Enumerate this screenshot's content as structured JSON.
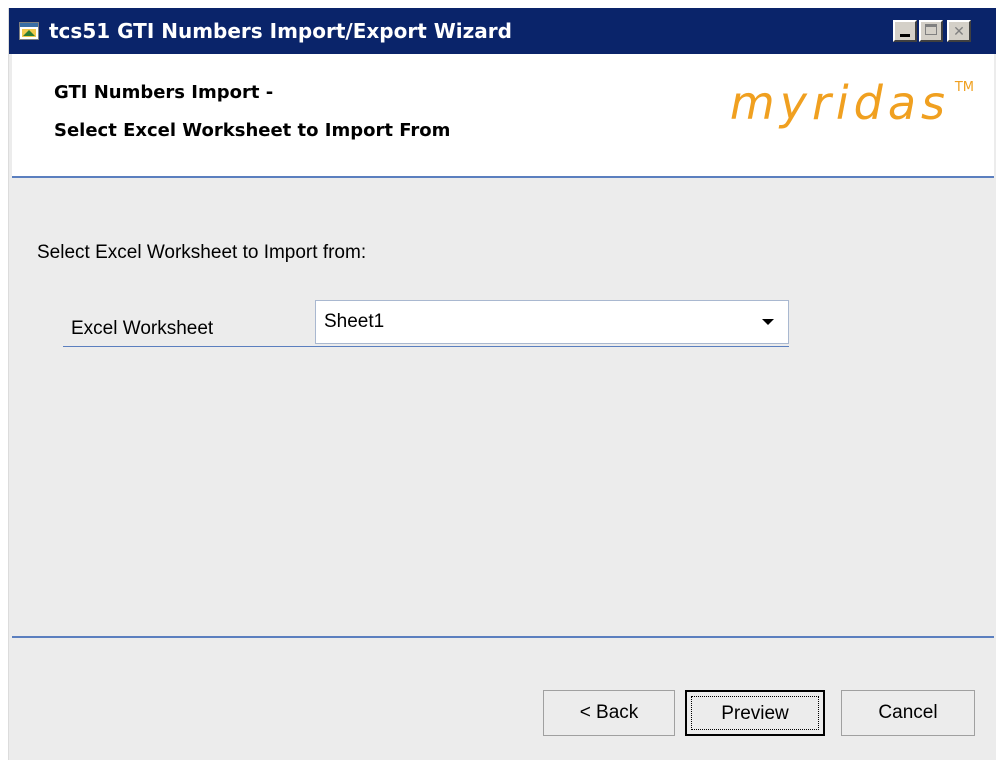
{
  "window": {
    "title": "tcs51 GTI Numbers Import/Export Wizard",
    "icon": "wizard-app-icon",
    "title_bar_color": "#0a246a"
  },
  "header": {
    "line1": "GTI Numbers Import -",
    "line2": "Select Excel Worksheet to Import From",
    "brand": "myridas",
    "brand_tm": "TM",
    "brand_color": "#f0a020"
  },
  "content": {
    "instruction": "Select Excel Worksheet to Import from:",
    "field_label": "Excel Worksheet",
    "worksheet_value": "Sheet1"
  },
  "buttons": {
    "back": "< Back",
    "preview": "Preview",
    "cancel": "Cancel"
  },
  "accent_color": "#5b7fbf"
}
